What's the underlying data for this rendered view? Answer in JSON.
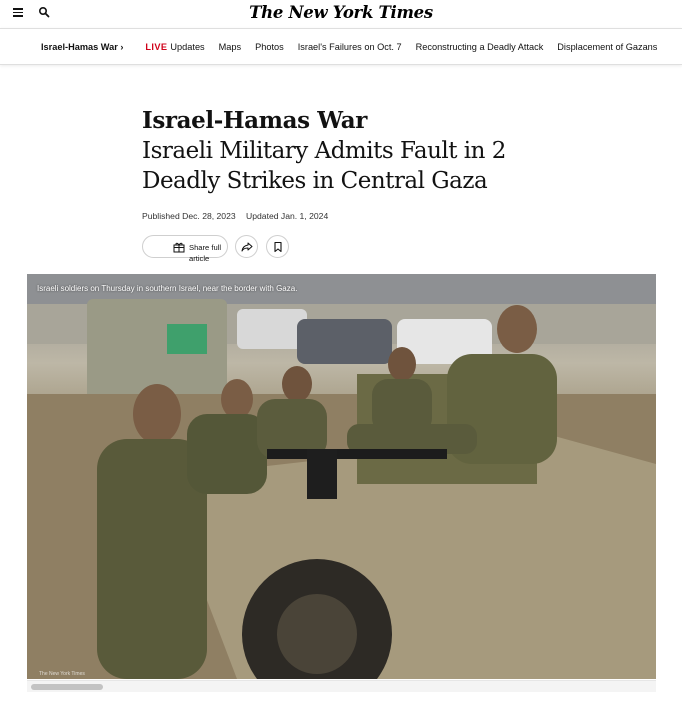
{
  "masthead": {
    "logo": "The New York Times"
  },
  "subnav": {
    "kicker": "Israel-Hamas War ›",
    "live_badge": "LIVE",
    "items": [
      "Updates",
      "Maps",
      "Photos",
      "Israel's Failures on Oct. 7",
      "Reconstructing a Deadly Attack",
      "Displacement of Gazans"
    ]
  },
  "article": {
    "section": "Israel-Hamas War",
    "title_line1": "Israeli Military Admits Fault in 2",
    "title_line2": "Deadly Strikes in Central Gaza",
    "published": "Published Dec. 28, 2023",
    "updated": "Updated Jan. 1, 2024"
  },
  "share": {
    "share_full_label": "Share full article"
  },
  "photo": {
    "caption": "Israeli soldiers on Thursday in southern Israel, near the border with Gaza.",
    "credit": "The New York Times"
  },
  "colors": {
    "live": "#d0021b",
    "text": "#121212",
    "border": "#dfdfdf"
  }
}
